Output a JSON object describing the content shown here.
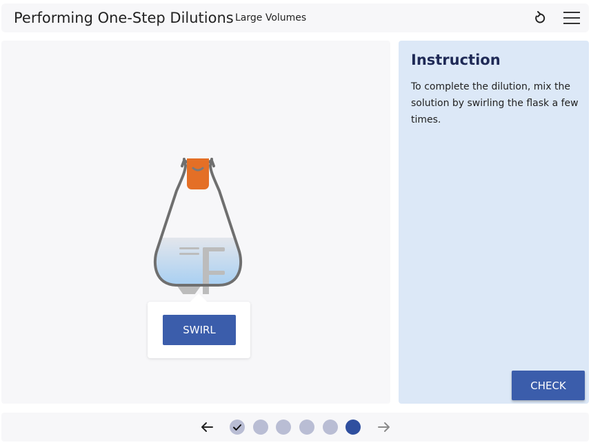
{
  "header": {
    "title": "Performing One-Step Dilutions",
    "subtitle": "Large Volumes",
    "reset_icon": "reset-icon",
    "menu_icon": "hamburger-menu-icon"
  },
  "simulation": {
    "flask_icon": "erlenmeyer-flask-with-stopper",
    "action_button_label": "SWIRL"
  },
  "instruction": {
    "title": "Instruction",
    "text": "To complete the dilution, mix the solution by swirling the flask a few times.",
    "check_label": "CHECK"
  },
  "footer": {
    "steps": [
      {
        "state": "completed",
        "icon": "checkmark-icon"
      },
      {
        "state": "upcoming"
      },
      {
        "state": "upcoming"
      },
      {
        "state": "upcoming"
      },
      {
        "state": "upcoming"
      },
      {
        "state": "current"
      }
    ],
    "prev_icon": "arrow-left-icon",
    "next_icon": "arrow-right-icon"
  },
  "colors": {
    "primary": "#3b5dab",
    "active_dot": "#2f4f9f",
    "inactive_dot": "#b9bdd4",
    "stopper": "#e46f26",
    "instruction_bg": "#dce8f7",
    "liquid": "#aacff2"
  }
}
